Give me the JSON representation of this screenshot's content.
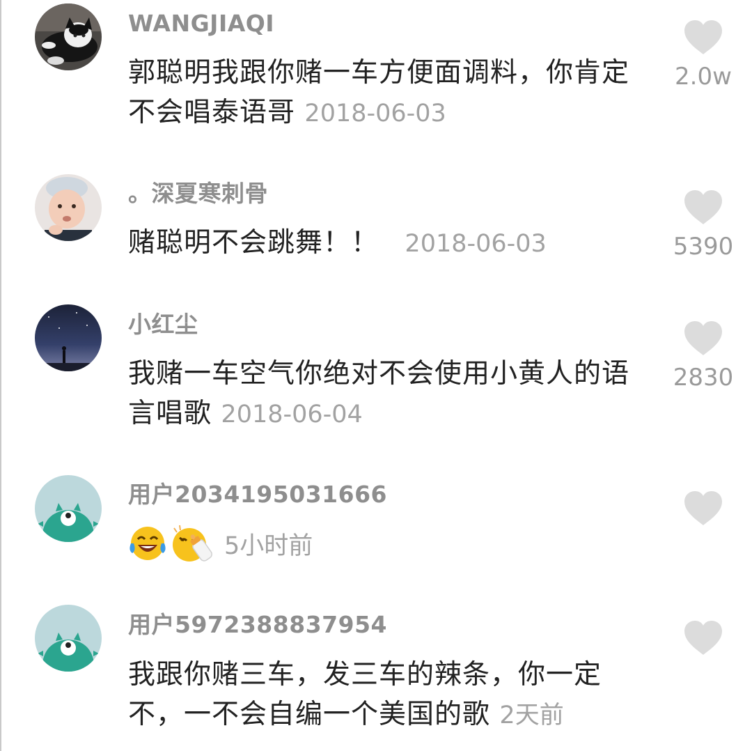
{
  "comments": [
    {
      "username": "WANGJIAQI",
      "text": "郭聪明我跟你赌一车方便面调料，你肯定不会唱泰语哥",
      "date": "2018-06-03",
      "likes": "2.0w",
      "avatar_icon": "cat-avatar-icon"
    },
    {
      "username": "。深夏寒刺骨",
      "text": "赌聪明不会跳舞！！",
      "date": "2018-06-03",
      "likes": "5390",
      "avatar_icon": "baby-avatar-icon"
    },
    {
      "username": "小红尘",
      "text": "我赌一车空气你绝对不会使用小黄人的语言唱歌",
      "date": "2018-06-04",
      "likes": "2830",
      "avatar_icon": "night-sky-avatar-icon"
    },
    {
      "username": "用户2034195031666",
      "emojis": [
        "laughing-crying-emoji",
        "baby-bottle-emoji"
      ],
      "date": "5小时前",
      "likes": "",
      "avatar_icon": "teal-monster-avatar-icon"
    },
    {
      "username": "用户5972388837954",
      "text": "我跟你赌三车，发三车的辣条，你一定不，一不会自编一个美国的歌",
      "date": "2天前",
      "likes": "",
      "avatar_icon": "teal-monster-avatar-icon"
    }
  ],
  "colors": {
    "username": "#8e8e8e",
    "body_text": "#222222",
    "date": "#a2a2a2",
    "heart": "#dcdcdc",
    "teal_avatar": "#2ba58f"
  }
}
